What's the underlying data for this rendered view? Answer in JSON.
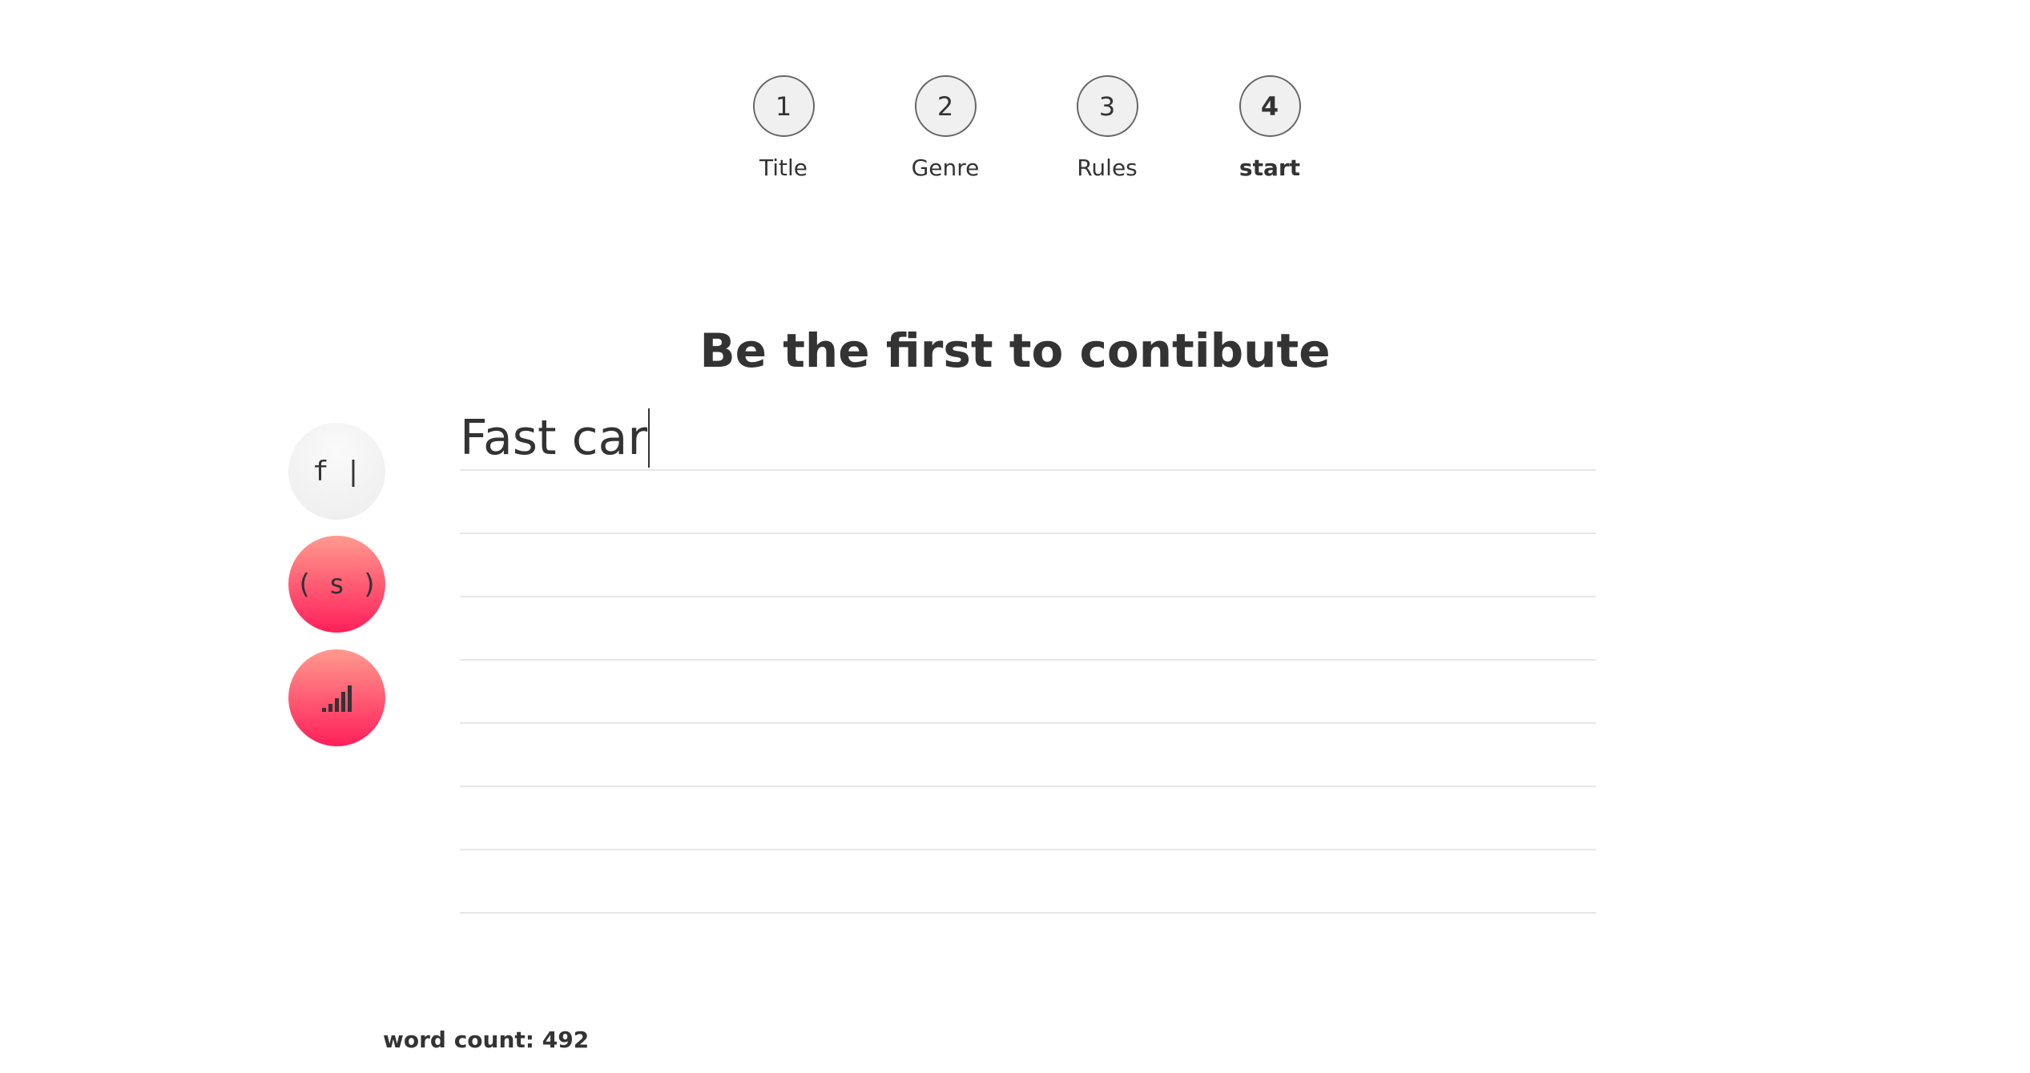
{
  "stepper": {
    "steps": [
      {
        "number": "1",
        "label": "Title",
        "active": false
      },
      {
        "number": "2",
        "label": "Genre",
        "active": false
      },
      {
        "number": "3",
        "label": "Rules",
        "active": false
      },
      {
        "number": "4",
        "label": "start",
        "active": true
      }
    ]
  },
  "heading": "Be the first to contibute",
  "side_buttons": {
    "font": {
      "label": "f |",
      "icon": "font-cursor-icon"
    },
    "sound": {
      "label": "( s )",
      "icon": "sound-icon",
      "color": "#ff3a66"
    },
    "stats": {
      "icon": "signal-bars-icon",
      "color": "#ff3a66"
    }
  },
  "editor": {
    "text": "Fast car"
  },
  "footer": {
    "word_count_label": "word count: 492"
  },
  "colors": {
    "text": "#333333",
    "accent_gradient_top": "#ff9a8e",
    "accent_gradient_bottom": "#ff1f5a",
    "line": "#e6e6e6"
  }
}
